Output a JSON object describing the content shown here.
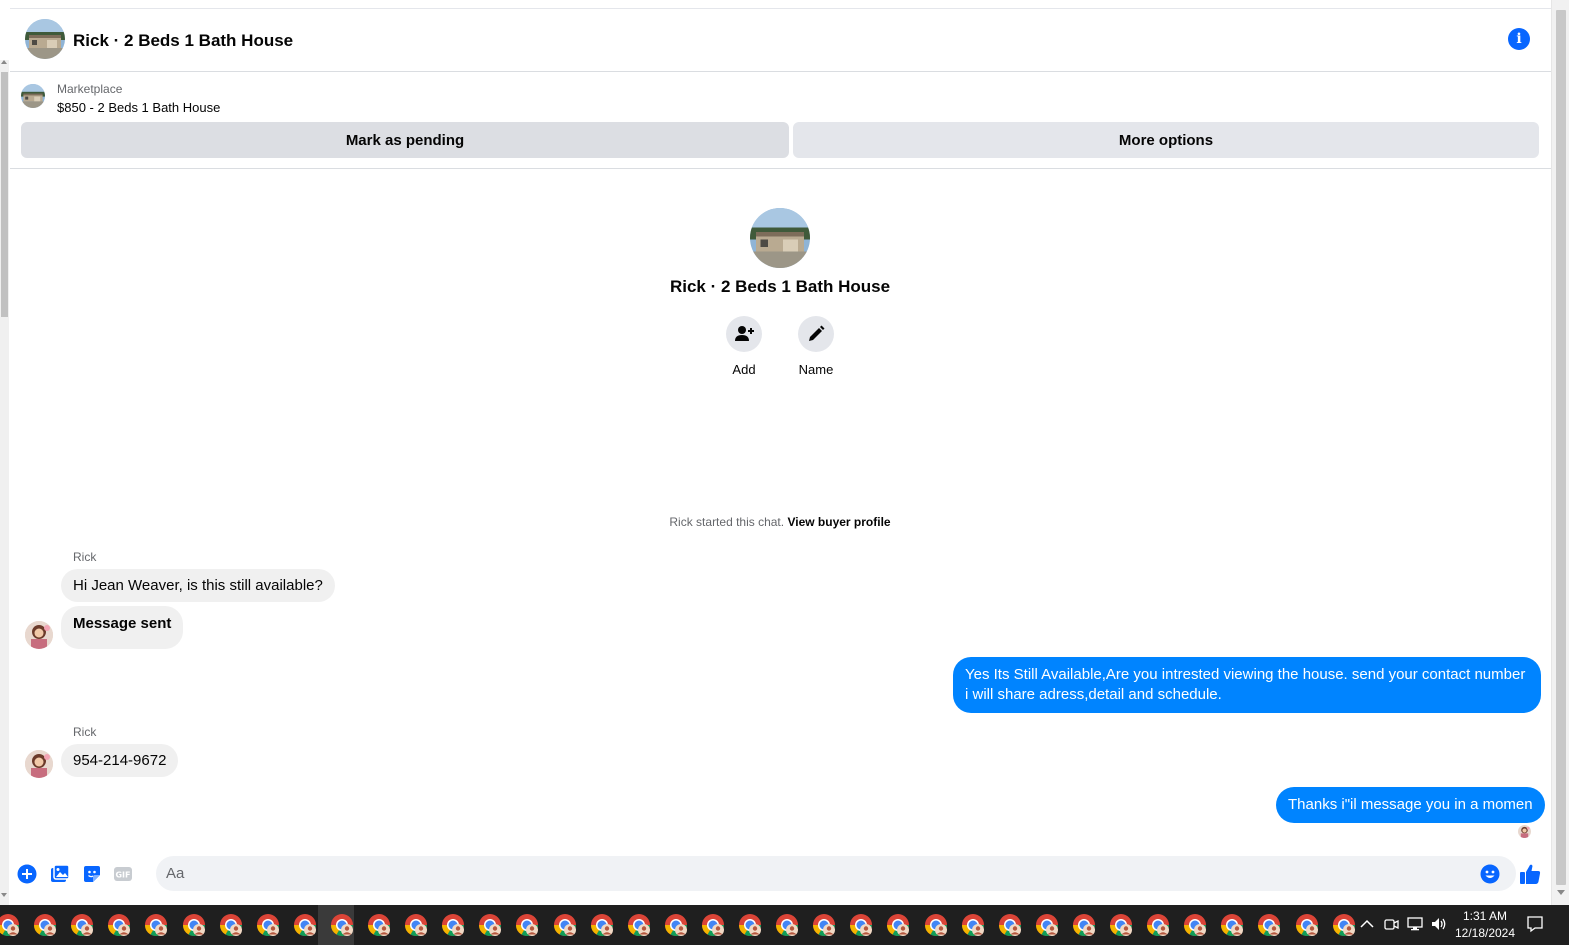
{
  "header": {
    "title": "Rick · 2 Beds 1 Bath House"
  },
  "listing": {
    "kicker": "Marketplace",
    "title": "$850 - 2 Beds 1 Bath House",
    "mark_pending_label": "Mark as pending",
    "more_options_label": "More options"
  },
  "intro": {
    "title": "Rick · 2 Beds 1 Bath House",
    "add_label": "Add",
    "name_label": "Name"
  },
  "started": {
    "text": "Rick started this chat.",
    "link": "View buyer profile"
  },
  "messages": [
    {
      "sender": "Rick",
      "text": "Hi Jean Weaver, is this still available?"
    },
    {
      "text": "Message sent"
    },
    {
      "text": "Yes Its Still Available,Are you intrested viewing the house. send your contact number i will share adress,detail and schedule."
    },
    {
      "sender": "Rick",
      "text": "954-214-9672"
    },
    {
      "text": "Thanks i\"il message you in a momen"
    }
  ],
  "composer": {
    "placeholder": "Aa"
  },
  "taskbar": {
    "time": "1:31 AM",
    "date": "12/18/2024"
  },
  "colors": {
    "accent": "#0084ff",
    "info": "#0866ff",
    "bubble_in": "#f0f0f0"
  }
}
